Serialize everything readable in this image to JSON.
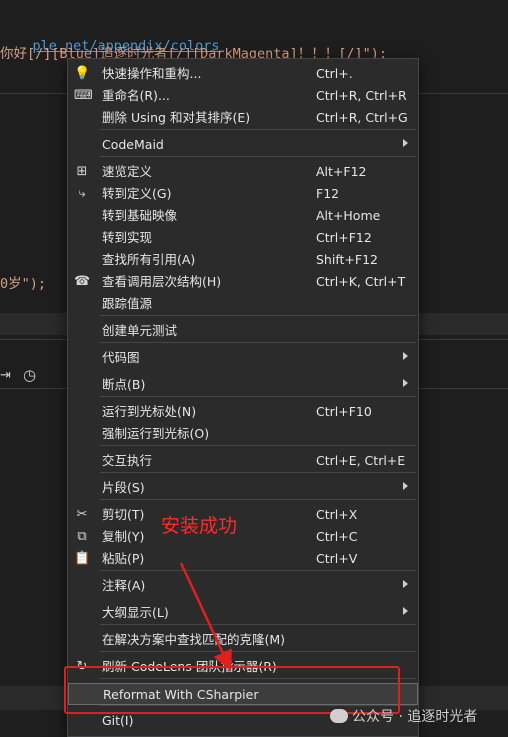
{
  "editor": {
    "line1_link": "ple.net/appendix/colors",
    "line2_text": "你好[/][Blue]追逐时光者[/][DarkMagenta]！！！[/]\");",
    "line3_text": "0岁\");"
  },
  "menu": {
    "items": [
      {
        "icon": "bulb-icon",
        "label": "快速操作和重构...",
        "shortcut": "Ctrl+."
      },
      {
        "icon": "rename-icon",
        "label": "重命名(R)...",
        "shortcut": "Ctrl+R, Ctrl+R"
      },
      {
        "icon": "",
        "label": "删除 Using 和对其排序(E)",
        "shortcut": "Ctrl+R, Ctrl+G"
      },
      {
        "icon": "",
        "label": "CodeMaid",
        "shortcut": "",
        "submenu": true
      },
      {
        "icon": "peek-definition-icon",
        "label": "速览定义",
        "shortcut": "Alt+F12"
      },
      {
        "icon": "goto-definition-icon",
        "label": "转到定义(G)",
        "shortcut": "F12"
      },
      {
        "icon": "",
        "label": "转到基础映像",
        "shortcut": "Alt+Home"
      },
      {
        "icon": "",
        "label": "转到实现",
        "shortcut": "Ctrl+F12"
      },
      {
        "icon": "",
        "label": "查找所有引用(A)",
        "shortcut": "Shift+F12"
      },
      {
        "icon": "call-hierarchy-icon",
        "label": "查看调用层次结构(H)",
        "shortcut": "Ctrl+K, Ctrl+T"
      },
      {
        "icon": "",
        "label": "跟踪值源",
        "shortcut": ""
      },
      {
        "icon": "",
        "label": "创建单元测试",
        "shortcut": ""
      },
      {
        "icon": "",
        "label": "代码图",
        "shortcut": "",
        "submenu": true
      },
      {
        "icon": "",
        "label": "断点(B)",
        "shortcut": "",
        "submenu": true
      },
      {
        "icon": "",
        "label": "运行到光标处(N)",
        "shortcut": "Ctrl+F10"
      },
      {
        "icon": "",
        "label": "强制运行到光标(O)",
        "shortcut": ""
      },
      {
        "icon": "",
        "label": "交互执行",
        "shortcut": "Ctrl+E, Ctrl+E"
      },
      {
        "icon": "",
        "label": "片段(S)",
        "shortcut": "",
        "submenu": true
      },
      {
        "icon": "scissors-icon",
        "label": "剪切(T)",
        "shortcut": "Ctrl+X"
      },
      {
        "icon": "copy-icon",
        "label": "复制(Y)",
        "shortcut": "Ctrl+C"
      },
      {
        "icon": "paste-icon",
        "label": "粘贴(P)",
        "shortcut": "Ctrl+V"
      },
      {
        "icon": "",
        "label": "注释(A)",
        "shortcut": "",
        "submenu": true
      },
      {
        "icon": "",
        "label": "大纲显示(L)",
        "shortcut": "",
        "submenu": true
      },
      {
        "icon": "",
        "label": "在解决方案中查找匹配的克隆(M)",
        "shortcut": ""
      },
      {
        "icon": "refresh-icon",
        "label": "刷新 CodeLens 团队指示器(R)",
        "shortcut": ""
      },
      {
        "icon": "",
        "label": "Reformat With CSharpier",
        "shortcut": ""
      },
      {
        "icon": "",
        "label": "Git(I)",
        "shortcut": ""
      }
    ]
  },
  "annotation": {
    "text": "安装成功",
    "color": "#ff2a2a"
  },
  "watermark": {
    "text": "公众号 · 追逐时光者"
  }
}
